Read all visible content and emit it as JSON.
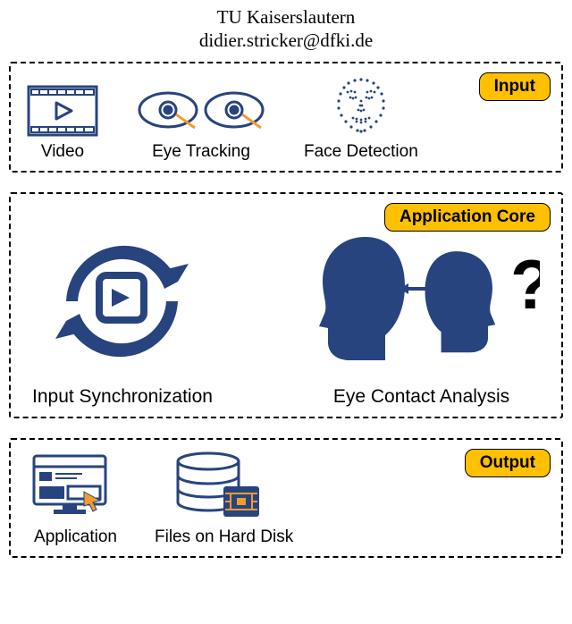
{
  "header": {
    "affiliation": "TU Kaiserslautern",
    "email": "didier.stricker@dfki.de"
  },
  "blocks": {
    "input": {
      "label": "Input",
      "items": [
        {
          "name": "video",
          "caption": "Video"
        },
        {
          "name": "eye-tracking",
          "caption": "Eye Tracking"
        },
        {
          "name": "face-detection",
          "caption": "Face Detection"
        }
      ]
    },
    "core": {
      "label": "Application Core",
      "items": [
        {
          "name": "input-sync",
          "caption": "Input Synchronization"
        },
        {
          "name": "eye-contact",
          "caption": "Eye Contact Analysis"
        }
      ]
    },
    "output": {
      "label": "Output",
      "items": [
        {
          "name": "application",
          "caption": "Application"
        },
        {
          "name": "files",
          "caption": "Files on Hard Disk"
        }
      ]
    }
  },
  "colors": {
    "primary": "#27447f",
    "badge": "#ffc000",
    "accent": "#f29c2e"
  }
}
